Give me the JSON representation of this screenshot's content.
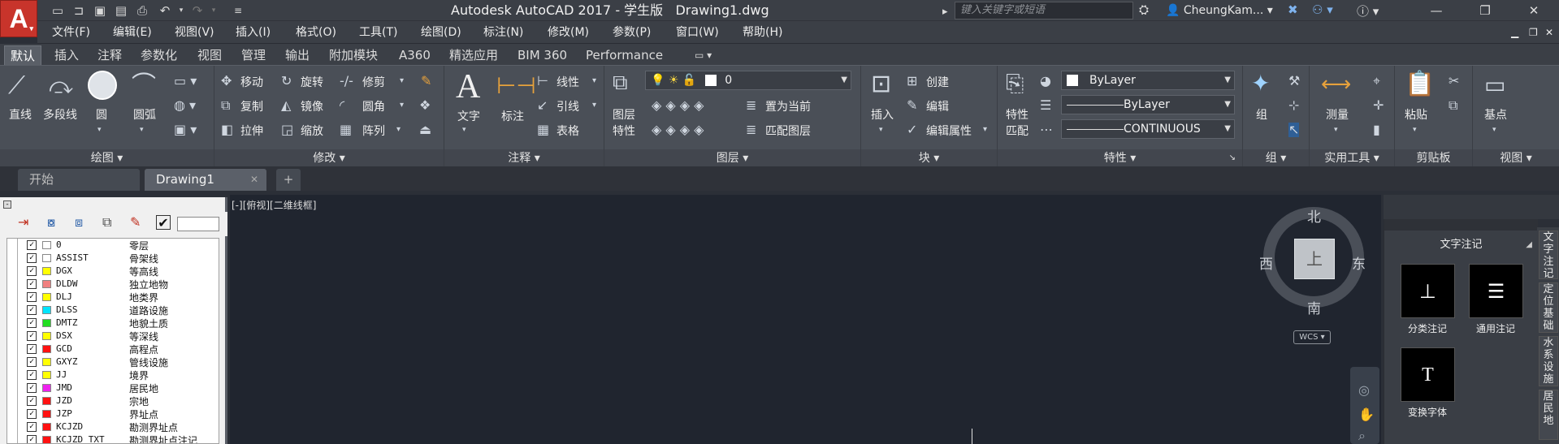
{
  "title": {
    "app": "Autodesk AutoCAD 2017 - 学生版",
    "doc": "Drawing1.dwg",
    "search_placeholder": "键入关键字或短语",
    "user": "CheungKam..."
  },
  "menu": [
    "文件(F)",
    "编辑(E)",
    "视图(V)",
    "插入(I)",
    "格式(O)",
    "工具(T)",
    "绘图(D)",
    "标注(N)",
    "修改(M)",
    "参数(P)",
    "窗口(W)",
    "帮助(H)"
  ],
  "ribbon_tabs": [
    "默认",
    "插入",
    "注释",
    "参数化",
    "视图",
    "管理",
    "输出",
    "附加模块",
    "A360",
    "精选应用",
    "BIM 360",
    "Performance"
  ],
  "panels": {
    "draw": {
      "title": "绘图",
      "line": "直线",
      "polyline": "多段线",
      "circle": "圆",
      "arc": "圆弧"
    },
    "modify": {
      "title": "修改",
      "move": "移动",
      "rotate": "旋转",
      "trim": "修剪",
      "copy": "复制",
      "mirror": "镜像",
      "fillet": "圆角",
      "stretch": "拉伸",
      "scale": "缩放",
      "array": "阵列"
    },
    "annotation": {
      "title": "注释",
      "text": "文字",
      "dim": "标注",
      "linear": "线性",
      "leader": "引线",
      "table": "表格"
    },
    "layers": {
      "title": "图层",
      "props_1": "图层",
      "props_2": "特性",
      "current_layer": "0",
      "set_current": "置为当前",
      "match_layer": "匹配图层"
    },
    "block": {
      "title": "块",
      "insert": "插入",
      "create": "创建",
      "edit": "编辑",
      "edit_attr": "编辑属性"
    },
    "properties": {
      "title": "特性",
      "match_1": "特性",
      "match_2": "匹配",
      "color": "ByLayer",
      "linetype": "ByLayer",
      "lineweight": "CONTINUOUS"
    },
    "groups": {
      "title": "组",
      "group": "组"
    },
    "utilities": {
      "title": "实用工具",
      "measure": "测量"
    },
    "clipboard": {
      "title": "剪贴板",
      "paste": "粘贴"
    },
    "view": {
      "title": "视图",
      "base": "基点"
    }
  },
  "doc_tabs": [
    "开始",
    "Drawing1"
  ],
  "viewport_label": "[-][俯视][二维线框]",
  "compass": {
    "n": "北",
    "s": "南",
    "e": "东",
    "w": "西",
    "cube": "上",
    "wcs": "WCS"
  },
  "layers": [
    {
      "name": "0",
      "desc": "零层",
      "color": "#ffffff"
    },
    {
      "name": "ASSIST",
      "desc": "骨架线",
      "color": "#ffffff"
    },
    {
      "name": "DGX",
      "desc": "等高线",
      "color": "#ffff00"
    },
    {
      "name": "DLDW",
      "desc": "独立地物",
      "color": "#f08080"
    },
    {
      "name": "DLJ",
      "desc": "地类界",
      "color": "#ffff00"
    },
    {
      "name": "DLSS",
      "desc": "道路设施",
      "color": "#00e5ff"
    },
    {
      "name": "DMTZ",
      "desc": "地貌土质",
      "color": "#22dd22"
    },
    {
      "name": "DSX",
      "desc": "等深线",
      "color": "#ffff00"
    },
    {
      "name": "GCD",
      "desc": "高程点",
      "color": "#ff1111"
    },
    {
      "name": "GXYZ",
      "desc": "管线设施",
      "color": "#ffff00"
    },
    {
      "name": "JJ",
      "desc": "境界",
      "color": "#ffff00"
    },
    {
      "name": "JMD",
      "desc": "居民地",
      "color": "#ee22ee"
    },
    {
      "name": "JZD",
      "desc": "宗地",
      "color": "#ff1111"
    },
    {
      "name": "JZP",
      "desc": "界址点",
      "color": "#ff1111"
    },
    {
      "name": "KCJZD",
      "desc": "勘测界址点",
      "color": "#ff1111"
    },
    {
      "name": "KCJZD_TXT",
      "desc": "勘测界址点注记",
      "color": "#ff1111"
    }
  ],
  "right_panel": {
    "title": "文字注记",
    "tools": [
      "分类注记",
      "通用注记",
      "变换字体"
    ],
    "side_tabs": [
      "文字注记",
      "定位基础",
      "水系设施",
      "居民地"
    ]
  }
}
